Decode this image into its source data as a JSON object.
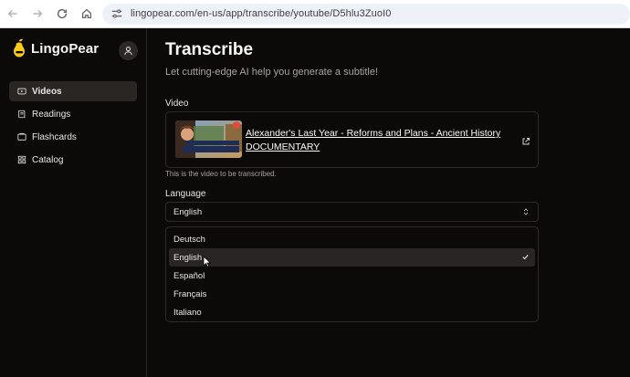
{
  "browser": {
    "url": "lingopear.com/en-us/app/transcribe/youtube/D5hlu3ZuoI0"
  },
  "brand": {
    "name": "LingoPear"
  },
  "sidebar": {
    "items": [
      {
        "label": "Videos",
        "icon": "video-icon",
        "active": true
      },
      {
        "label": "Readings",
        "icon": "book-icon",
        "active": false
      },
      {
        "label": "Flashcards",
        "icon": "cards-icon",
        "active": false
      },
      {
        "label": "Catalog",
        "icon": "grid-icon",
        "active": false
      }
    ]
  },
  "main": {
    "title": "Transcribe",
    "subtitle": "Let cutting-edge AI help you generate a subtitle!",
    "video_label": "Video",
    "video_title": "Alexander's Last Year - Reforms and Plans - Ancient History DOCUMENTARY",
    "thumbnail_caption": "ALEXANDER'S LAST YEAR",
    "helper_text": "This is the video to be transcribed.",
    "language_label": "Language",
    "language_selected": "English",
    "language_options": [
      "Deutsch",
      "English",
      "Español",
      "Français",
      "Italiano"
    ]
  },
  "colors": {
    "background": "#0c0a09",
    "logo_accent": "#facc15",
    "text": "#fafaf9"
  }
}
